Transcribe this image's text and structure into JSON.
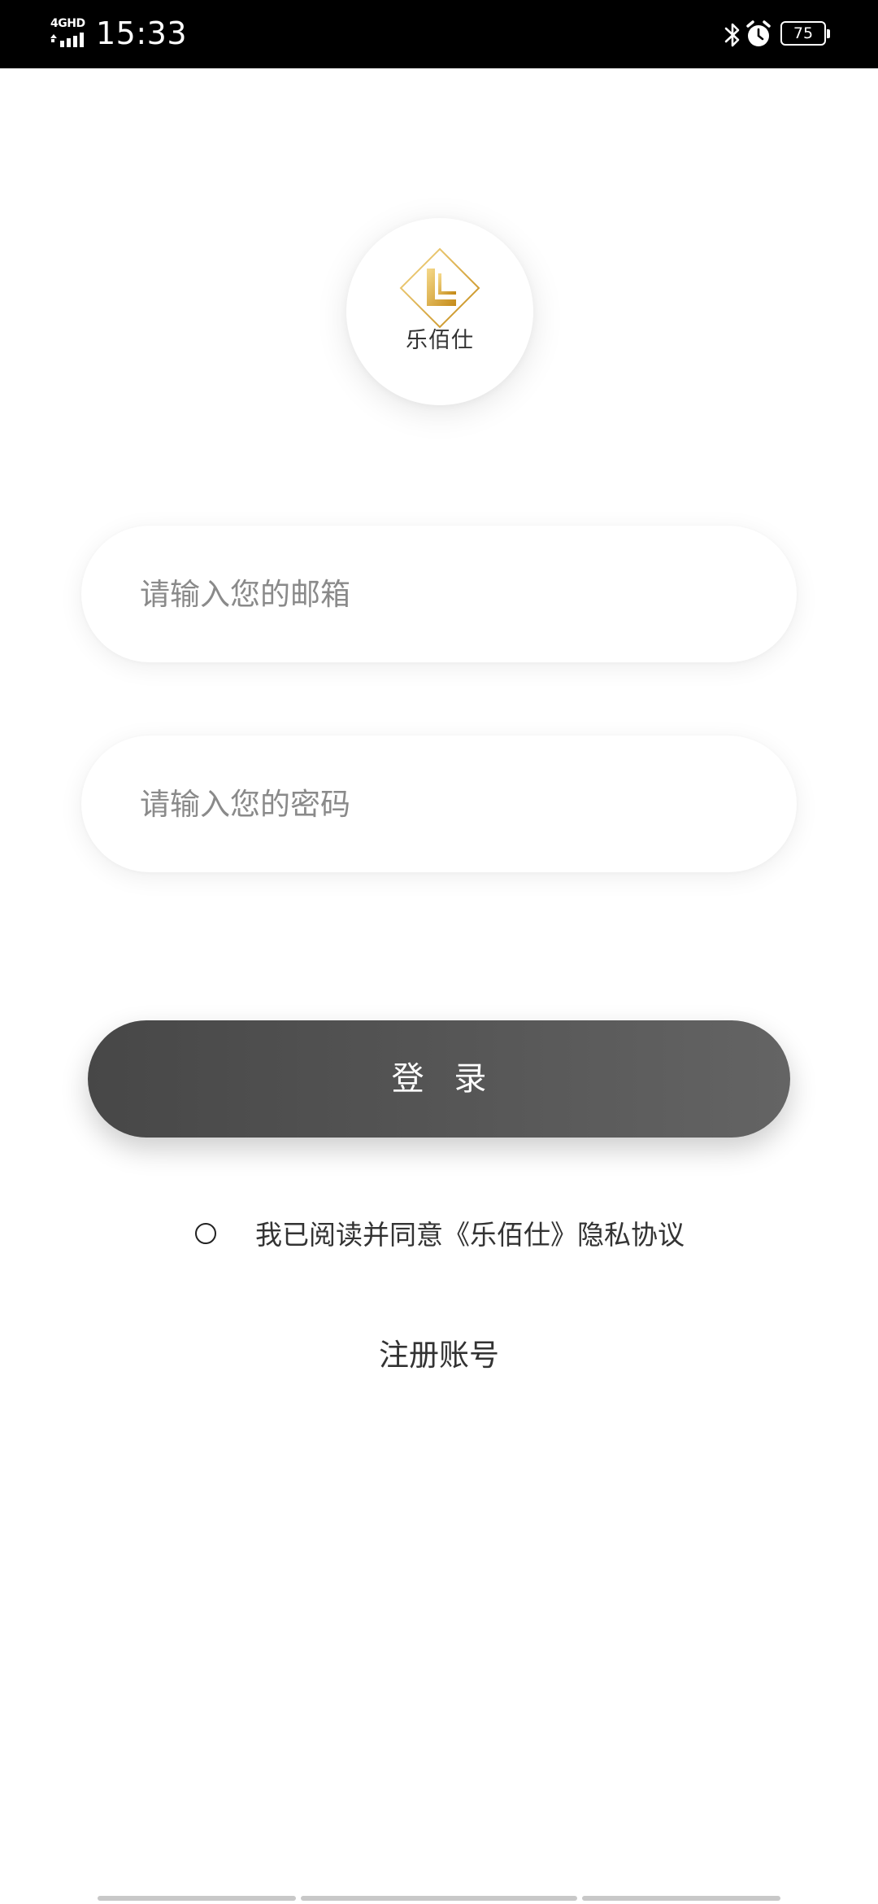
{
  "status_bar": {
    "network": "4GHD",
    "time": "15:33",
    "battery": "75"
  },
  "logo": {
    "name": "乐佰仕",
    "colors": {
      "gold_light": "#f3d27a",
      "gold_dark": "#c8911f"
    }
  },
  "form": {
    "email_placeholder": "请输入您的邮箱",
    "email_value": "",
    "password_placeholder": "请输入您的密码",
    "password_value": ""
  },
  "login_button": {
    "label": "登 录",
    "color": "#555555"
  },
  "agreement": {
    "checked": false,
    "text": "我已阅读并同意《乐佰仕》隐私协议"
  },
  "register": {
    "label": "注册账号"
  },
  "icons": {
    "signal": "signal-bars-icon",
    "bluetooth": "bluetooth-icon",
    "alarm": "alarm-clock-icon",
    "battery": "battery-icon"
  }
}
